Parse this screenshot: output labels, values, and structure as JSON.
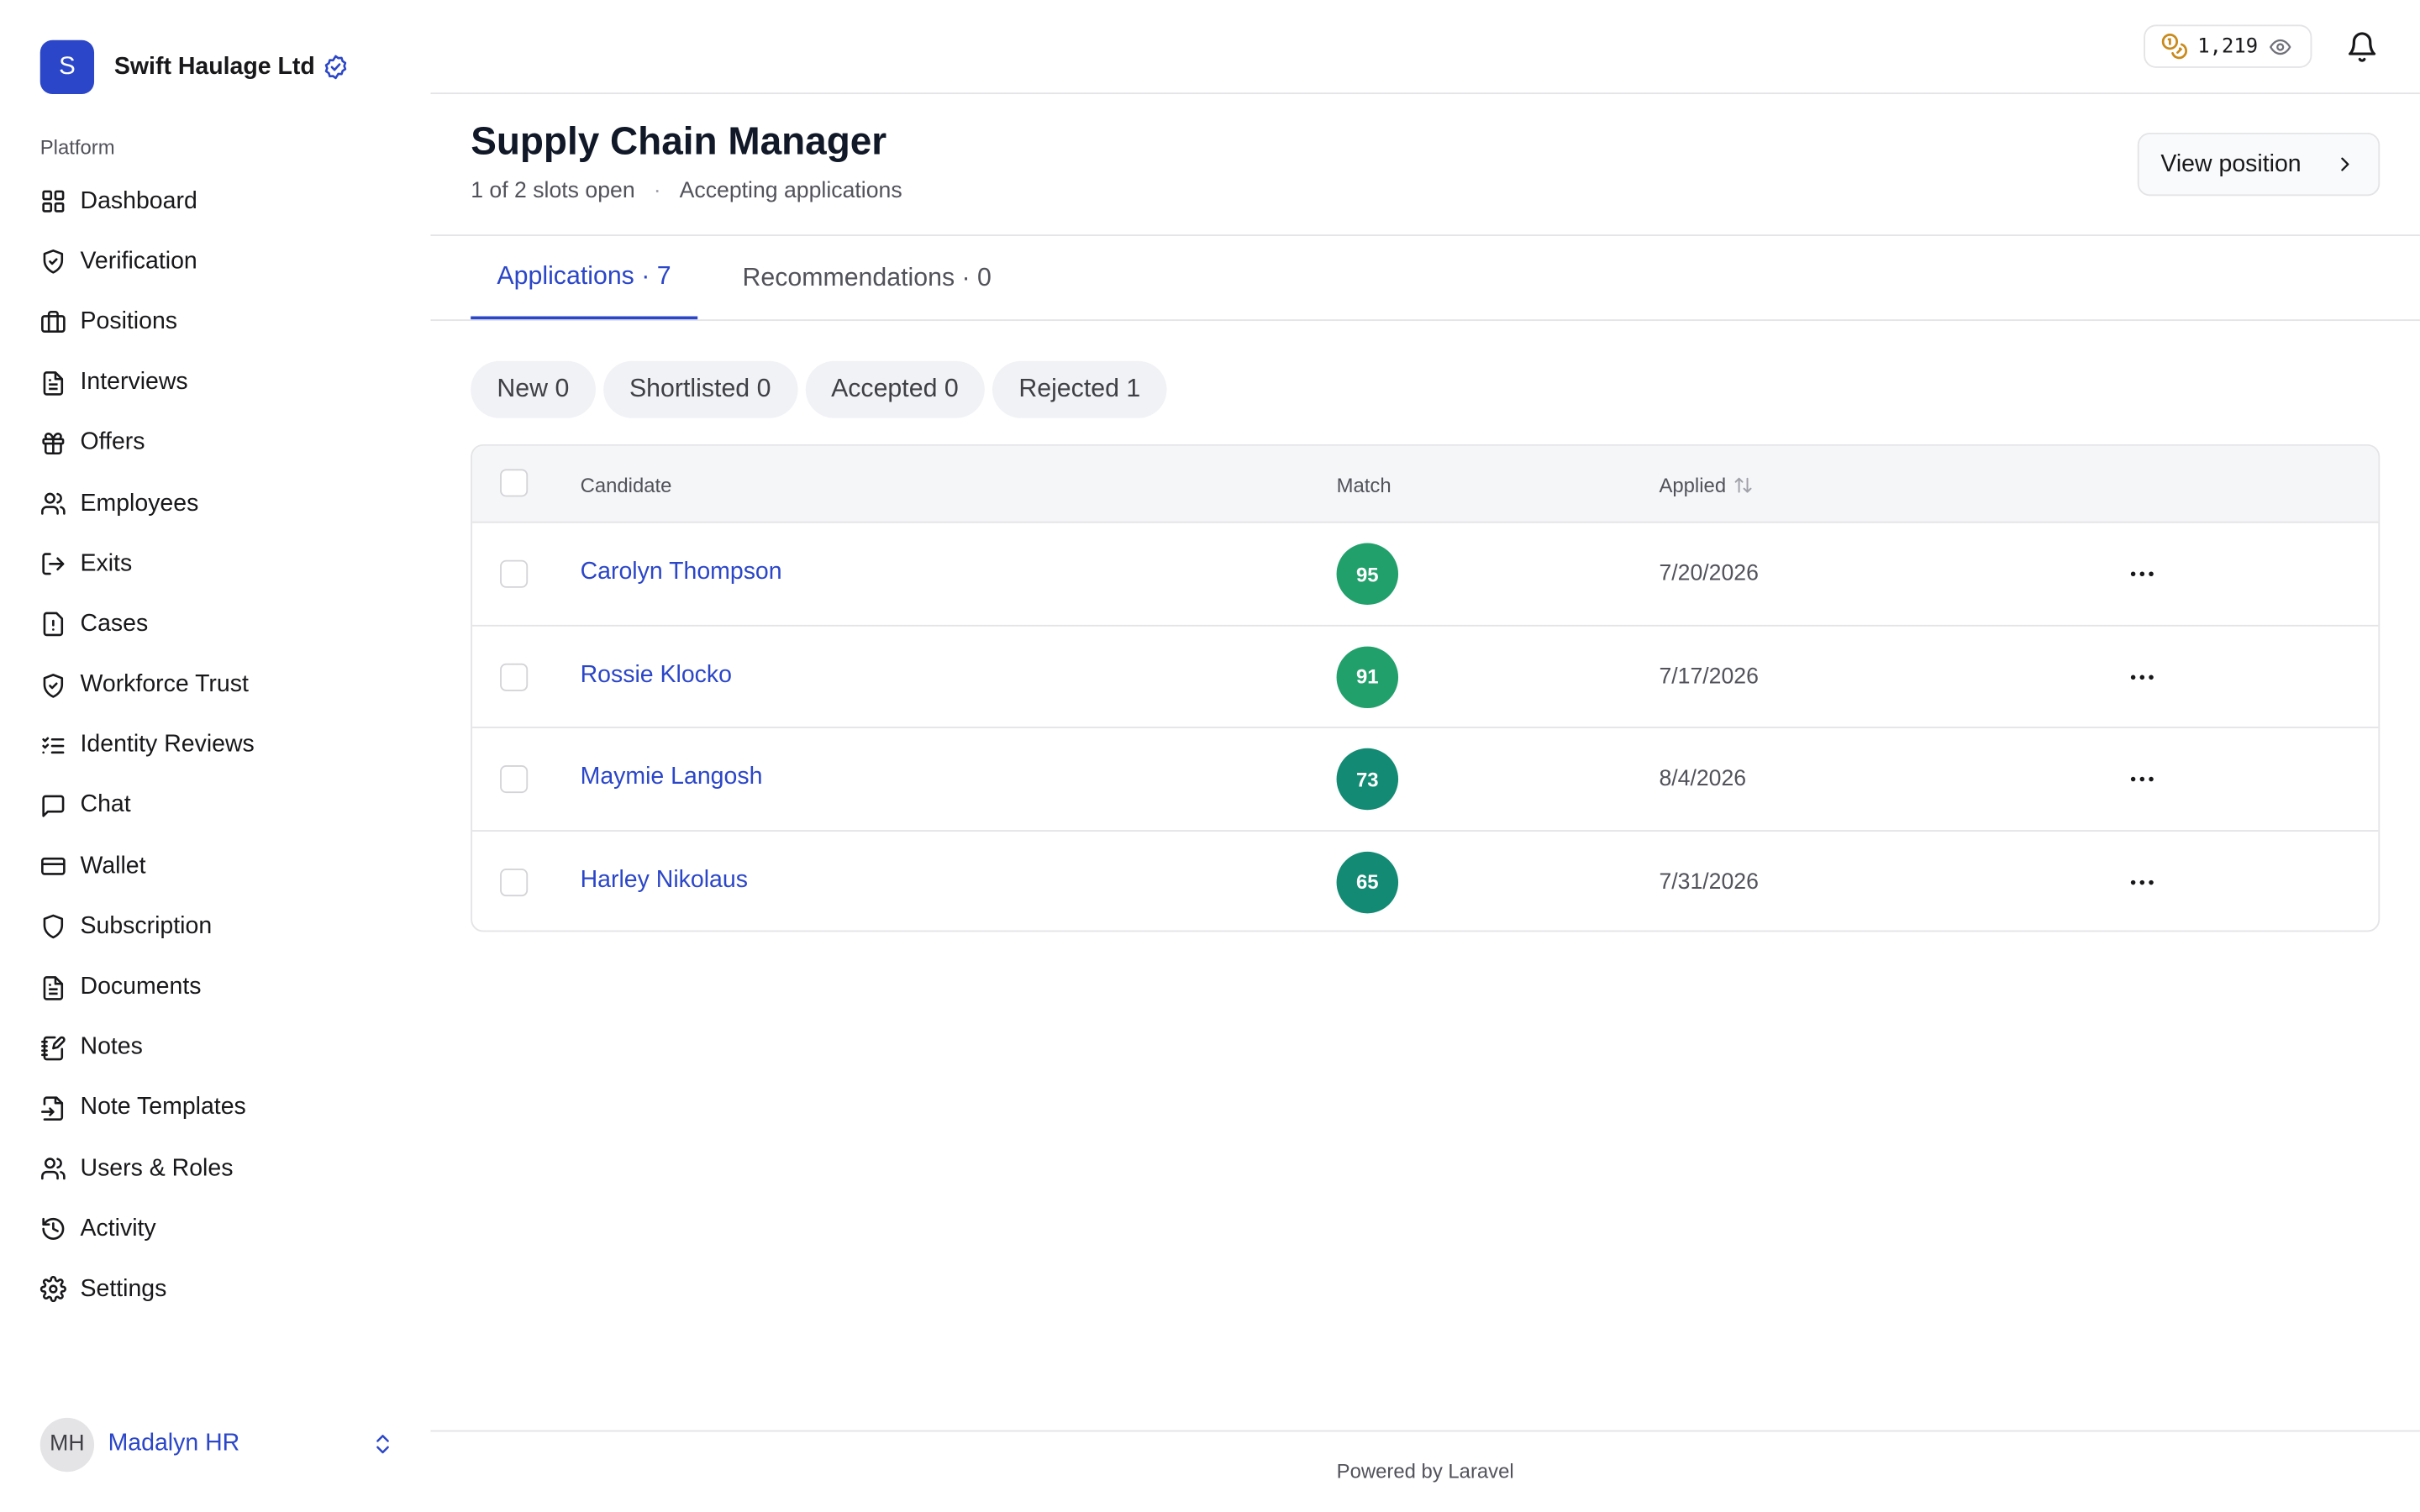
{
  "brand": {
    "initial": "S",
    "name": "Swift Haulage Ltd"
  },
  "sidebar": {
    "section_label": "Platform",
    "items": [
      {
        "label": "Dashboard",
        "icon": "grid-icon"
      },
      {
        "label": "Verification",
        "icon": "shield-check-icon"
      },
      {
        "label": "Positions",
        "icon": "briefcase-icon"
      },
      {
        "label": "Interviews",
        "icon": "document-icon"
      },
      {
        "label": "Offers",
        "icon": "gift-icon"
      },
      {
        "label": "Employees",
        "icon": "users-icon"
      },
      {
        "label": "Exits",
        "icon": "log-out-icon"
      },
      {
        "label": "Cases",
        "icon": "file-alert-icon"
      },
      {
        "label": "Workforce Trust",
        "icon": "shield-check-icon"
      },
      {
        "label": "Identity Reviews",
        "icon": "checklist-icon"
      },
      {
        "label": "Chat",
        "icon": "chat-icon"
      },
      {
        "label": "Wallet",
        "icon": "credit-card-icon"
      },
      {
        "label": "Subscription",
        "icon": "shield-icon"
      },
      {
        "label": "Documents",
        "icon": "document-icon"
      },
      {
        "label": "Notes",
        "icon": "notebook-pen-icon"
      },
      {
        "label": "Note Templates",
        "icon": "file-input-icon"
      },
      {
        "label": "Users & Roles",
        "icon": "users-icon"
      },
      {
        "label": "Activity",
        "icon": "history-icon"
      },
      {
        "label": "Settings",
        "icon": "gear-icon"
      }
    ]
  },
  "user": {
    "initials": "MH",
    "name": "Madalyn HR"
  },
  "topbar": {
    "credits": "1,219"
  },
  "header": {
    "title": "Supply Chain Manager",
    "slots": "1 of 2 slots open",
    "separator": "·",
    "status": "Accepting applications",
    "view_button": "View position"
  },
  "tabs": [
    {
      "label": "Applications · 7",
      "active": true
    },
    {
      "label": "Recommendations · 0",
      "active": false
    }
  ],
  "filters": [
    {
      "label": "New 0"
    },
    {
      "label": "Shortlisted 0"
    },
    {
      "label": "Accepted 0"
    },
    {
      "label": "Rejected 1"
    }
  ],
  "table": {
    "columns": {
      "candidate": "Candidate",
      "match": "Match",
      "applied": "Applied"
    },
    "rows": [
      {
        "name": "Carolyn Thompson",
        "match": "95",
        "applied": "7/20/2026",
        "match_color": "#22a06b"
      },
      {
        "name": "Rossie Klocko",
        "match": "91",
        "applied": "7/17/2026",
        "match_color": "#22a06b"
      },
      {
        "name": "Maymie Langosh",
        "match": "73",
        "applied": "8/4/2026",
        "match_color": "#138a73"
      },
      {
        "name": "Harley Nikolaus",
        "match": "65",
        "applied": "7/31/2026",
        "match_color": "#138a73"
      }
    ]
  },
  "footer": {
    "text": "Powered by Laravel"
  },
  "colors": {
    "accent": "#2b46c8",
    "border": "#e4e4e7"
  }
}
